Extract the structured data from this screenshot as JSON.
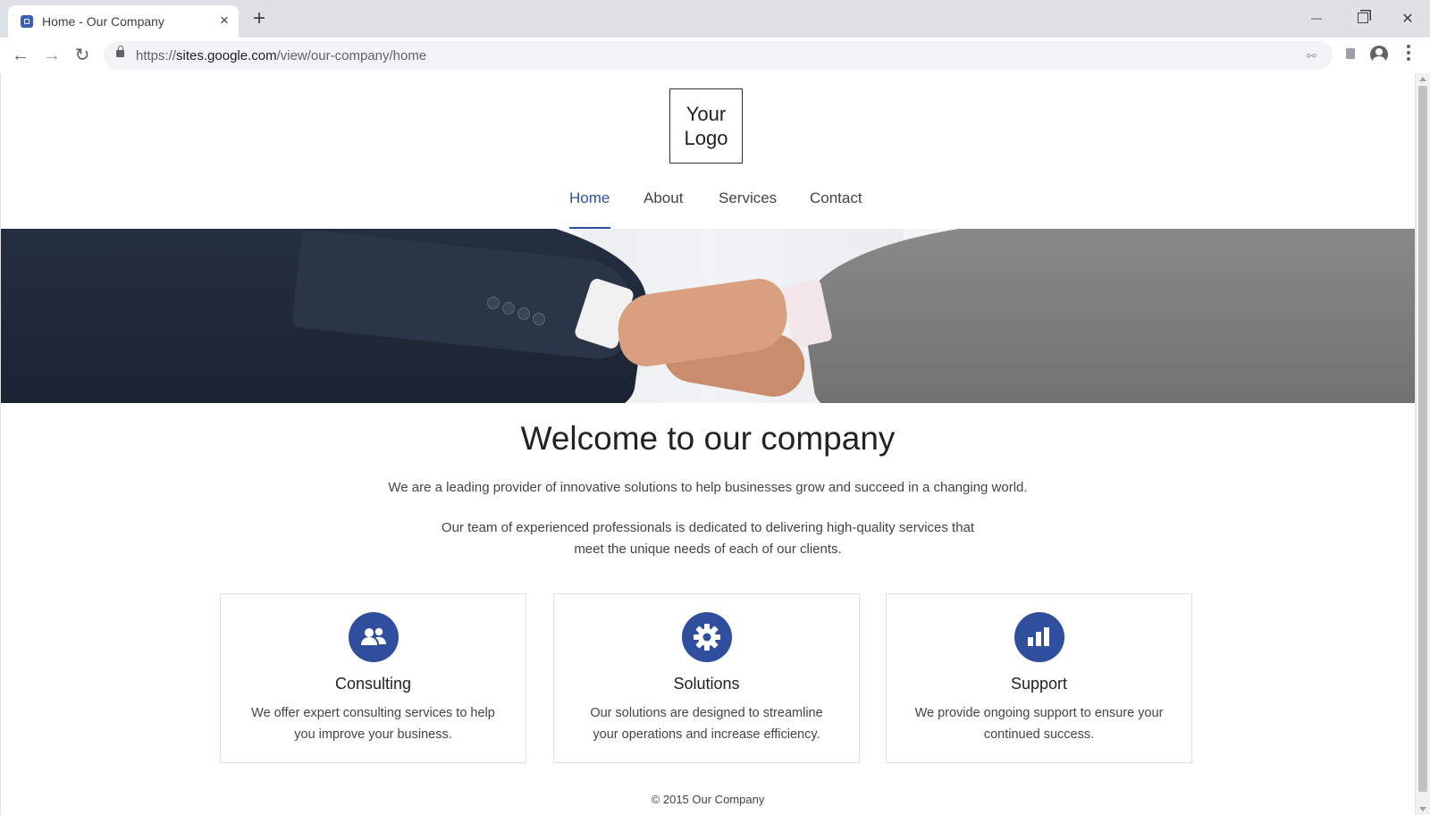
{
  "browser": {
    "tab_title": "Home - Our Company",
    "tab_close": "×",
    "new_tab": "+",
    "url_prefix": "https://",
    "url_host": "sites.google.com",
    "url_path": "/view/our-company/home",
    "window_minimize": "—",
    "window_close": "✕"
  },
  "site": {
    "logo_text": "Your Logo",
    "nav": {
      "items": [
        {
          "label": "Home",
          "active": true
        },
        {
          "label": "About",
          "active": false
        },
        {
          "label": "Services",
          "active": false
        },
        {
          "label": "Contact",
          "active": false
        }
      ]
    },
    "welcome": {
      "title": "Welcome to our company",
      "paragraph_1": "We are a leading provider of innovative solutions to help businesses grow and succeed in a changing world.",
      "paragraph_2": "Our team of experienced professionals is dedicated to delivering high-quality services that meet the unique needs of each of our clients."
    },
    "cards": [
      {
        "icon": "users-icon",
        "title": "Consulting",
        "description": "We offer expert consulting services to help you improve your business."
      },
      {
        "icon": "gear-icon",
        "title": "Solutions",
        "description": "Our solutions are designed to streamline your operations and increase efficiency."
      },
      {
        "icon": "bar-chart-icon",
        "title": "Support",
        "description": "We provide ongoing support to ensure your continued success."
      }
    ],
    "footer": "© 2015 Our Company"
  },
  "colors": {
    "accent": "#2f4f9e",
    "text": "#444444",
    "chrome_bg": "#dee1e6"
  }
}
